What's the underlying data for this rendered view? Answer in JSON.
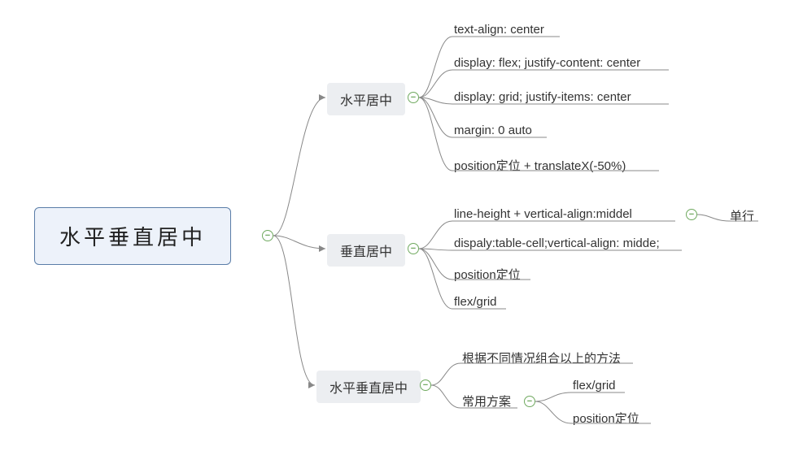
{
  "root": {
    "label": "水平垂直居中"
  },
  "branches": [
    {
      "label": "水平居中",
      "leaves": [
        "text-align: center",
        "display: flex; justify-content: center",
        "display: grid; justify-items: center",
        "margin: 0 auto",
        "position定位 + translateX(-50%)"
      ]
    },
    {
      "label": "垂直居中",
      "leaves": [
        {
          "text": "line-height + vertical-align:middel",
          "extra": "单行"
        },
        "dispaly:table-cell;vertical-align: midde;",
        "position定位",
        "flex/grid"
      ]
    },
    {
      "label": "水平垂直居中",
      "leaves": [
        "根据不同情况组合以上的方法",
        {
          "text": "常用方案",
          "children": [
            "flex/grid",
            "position定位"
          ]
        }
      ]
    }
  ]
}
